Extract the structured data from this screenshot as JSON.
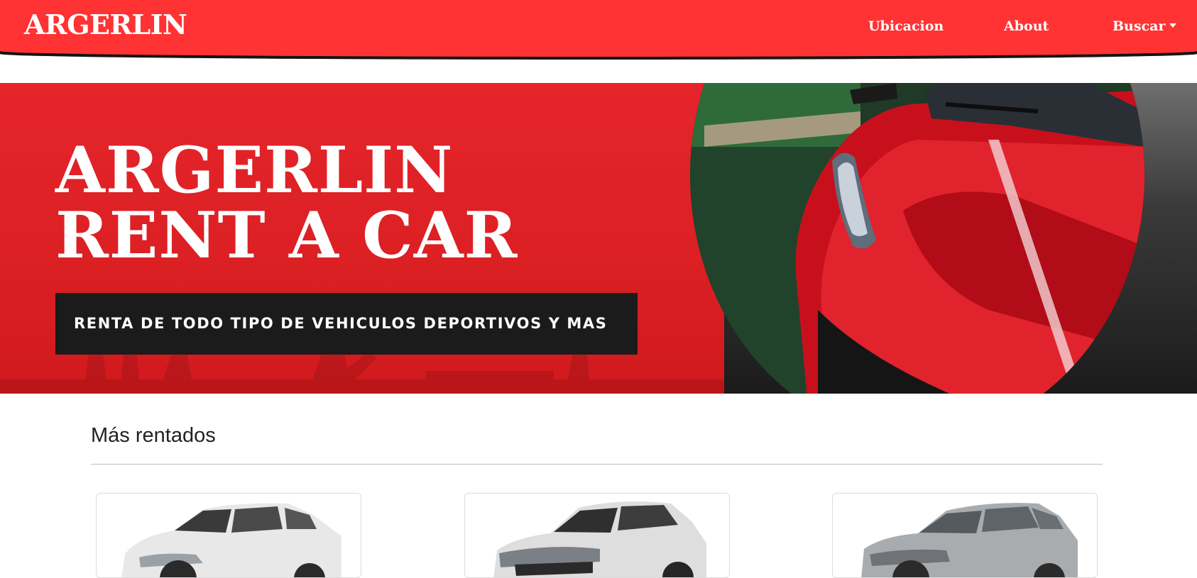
{
  "navbar": {
    "brand": "ARGERLIN",
    "links": [
      {
        "label": "Ubicacion"
      },
      {
        "label": "About"
      },
      {
        "label": "Buscar"
      }
    ]
  },
  "hero": {
    "title_line1": "ARGERLIN",
    "title_line2": "RENT A CAR",
    "tagline": "RENTA DE TODO TIPO DE VEHICULOS DEPORTIVOS Y MAS"
  },
  "section": {
    "title": "Más rentados"
  },
  "cards": [
    {
      "image": "white-suv"
    },
    {
      "image": "white-suv-front"
    },
    {
      "image": "silver-suv"
    }
  ],
  "colors": {
    "brand_red": "#ff3333",
    "hero_red": "#dc2024",
    "tagline_bg": "#1b1b1b"
  }
}
